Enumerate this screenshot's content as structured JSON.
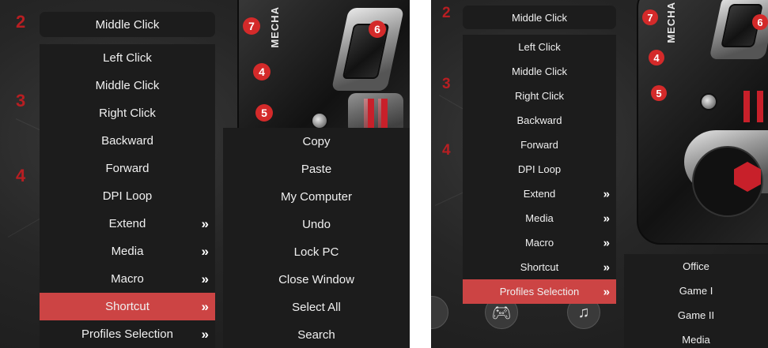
{
  "left": {
    "top_button": "Middle Click",
    "section_numbers": [
      "2",
      "3",
      "4"
    ],
    "badges": [
      "7",
      "4",
      "5",
      "6"
    ],
    "brand": "MECHA",
    "menu_items": [
      {
        "label": "Left Click"
      },
      {
        "label": "Middle Click"
      },
      {
        "label": "Right Click"
      },
      {
        "label": "Backward"
      },
      {
        "label": "Forward"
      },
      {
        "label": "DPI Loop"
      },
      {
        "label": "Extend",
        "arrow": "»"
      },
      {
        "label": "Media",
        "arrow": "»"
      },
      {
        "label": "Macro",
        "arrow": "»"
      },
      {
        "label": "Shortcut",
        "arrow": "»",
        "active": true
      },
      {
        "label": "Profiles Selection",
        "arrow": "»"
      }
    ],
    "submenu_items": [
      "Copy",
      "Paste",
      "My Computer",
      "Undo",
      "Lock PC",
      "Close Window",
      "Select All",
      "Search"
    ]
  },
  "right": {
    "top_button": "Middle Click",
    "section_numbers": [
      "2",
      "3",
      "4"
    ],
    "badges": [
      "7",
      "4",
      "5",
      "6"
    ],
    "brand": "MECHA",
    "menu_items": [
      {
        "label": "Left Click"
      },
      {
        "label": "Middle Click"
      },
      {
        "label": "Right Click"
      },
      {
        "label": "Backward"
      },
      {
        "label": "Forward"
      },
      {
        "label": "DPI Loop"
      },
      {
        "label": "Extend",
        "arrow": "»"
      },
      {
        "label": "Media",
        "arrow": "»"
      },
      {
        "label": "Macro",
        "arrow": "»"
      },
      {
        "label": "Shortcut",
        "arrow": "»"
      },
      {
        "label": "Profiles Selection",
        "arrow": "»",
        "active": true
      }
    ],
    "submenu_items": [
      "Office",
      "Game I",
      "Game II",
      "Media"
    ]
  },
  "colors": {
    "menu_bg": "#1c1c1c",
    "active_bg": "#cc4444",
    "badge_red": "#d42a2a",
    "number_red": "#b81e22"
  },
  "icons": [
    "gamepad-icon",
    "music-icon"
  ]
}
